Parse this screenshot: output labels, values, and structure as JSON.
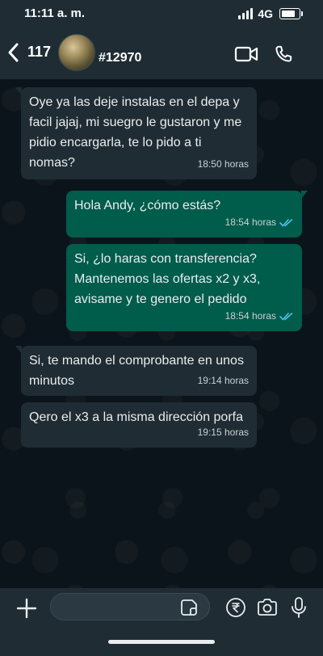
{
  "status_bar": {
    "time": "11:11 a. m.",
    "network": "4G"
  },
  "header": {
    "unread_count": "117",
    "contact_name": "#12970"
  },
  "messages": [
    {
      "direction": "incoming",
      "text": "Oye ya las deje instalas en el depa y facil jajaj, mi suegro le gustaron y me pidio encargarla, te lo pido a ti nomas?",
      "time": "18:50 horas"
    },
    {
      "direction": "outgoing",
      "text": "Hola Andy, ¿cómo estás?",
      "time": "18:54 horas",
      "status": "read"
    },
    {
      "direction": "outgoing",
      "text": "Si, ¿lo haras con transferencia? Mantenemos las ofertas x2 y x3, avisame y te genero el pedido",
      "time": "18:54 horas",
      "status": "read"
    },
    {
      "direction": "incoming",
      "text": "Si, te mando el comprobante en unos minutos",
      "time": "19:14 horas"
    },
    {
      "direction": "incoming",
      "text": "Qero el x3 a la misma dirección porfa",
      "time": "19:15 horas"
    }
  ],
  "input": {
    "placeholder": ""
  },
  "icons": {
    "back": "chevron-left-icon",
    "video": "video-call-icon",
    "call": "phone-icon",
    "attach": "plus-icon",
    "sticker": "sticker-icon",
    "payment": "rupee-icon",
    "camera": "camera-icon",
    "mic": "microphone-icon",
    "read_receipt": "double-check-icon"
  },
  "colors": {
    "incoming_bubble": "#202c33",
    "outgoing_bubble": "#005c4b",
    "read_tick": "#53bdeb",
    "bar": "#1f2c33"
  }
}
